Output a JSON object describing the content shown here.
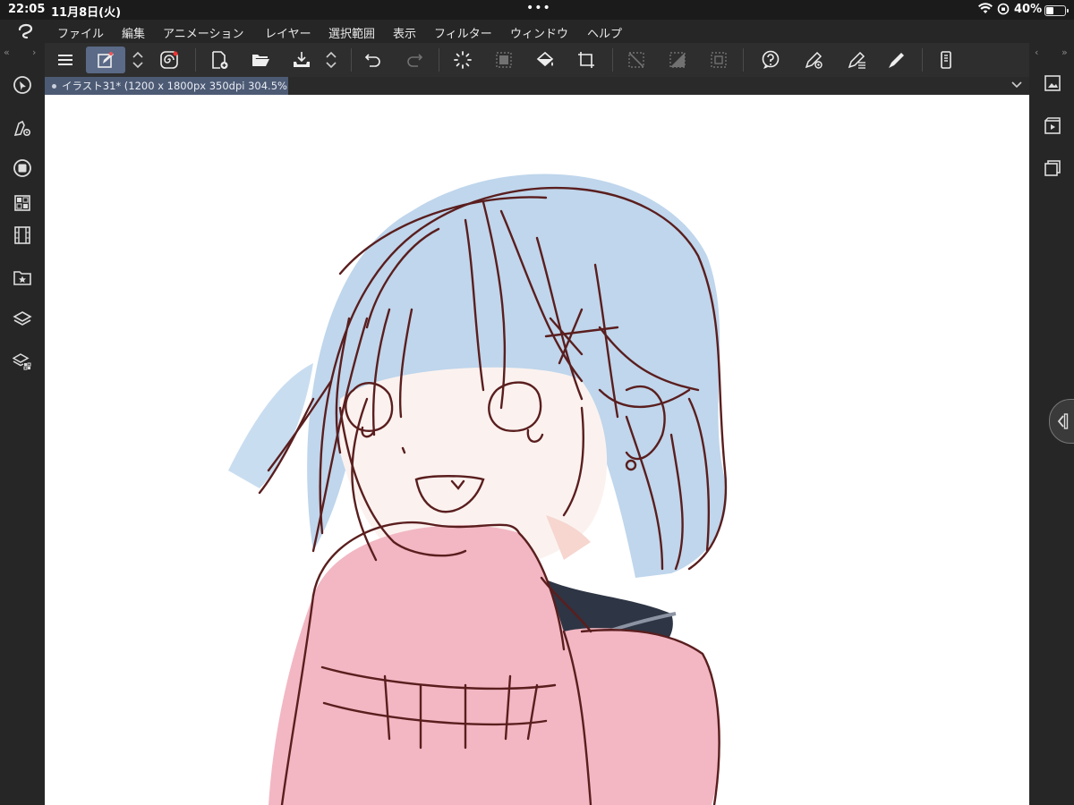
{
  "status_bar": {
    "time": "22:05",
    "date": "11月8日(火)",
    "battery_percent": "40%",
    "battery_level": 0.4
  },
  "menu": {
    "items": [
      "ファイル",
      "編集",
      "アニメーション",
      "レイヤー",
      "選択範囲",
      "表示",
      "フィルター",
      "ウィンドウ",
      "ヘルプ"
    ]
  },
  "toolbar": {
    "icons": [
      "menu-icon",
      "edit-tool-icon",
      "swap-updown-icon",
      "spiral-icon",
      "new-canvas-icon",
      "open-folder-icon",
      "save-icon",
      "swap-updown-icon",
      "undo-icon",
      "redo-icon",
      "loading-icon",
      "select-all-icon",
      "fill-icon",
      "crop-icon",
      "deselect-icon",
      "invert-selection-icon",
      "show-selection-icon",
      "help-icon",
      "pen-settings-icon",
      "pen-edit-icon",
      "brush-icon",
      "device-icon"
    ]
  },
  "document": {
    "tab_title": "イラスト31* (1200 x 1800px 350dpi 304.5%)"
  },
  "left_palette": {
    "icons": [
      "navigator-icon",
      "tool-settings-icon",
      "color-circle-icon",
      "color-set-icon",
      "timeline-icon",
      "materials-icon",
      "layers-icon",
      "layer-property-icon"
    ]
  },
  "right_palette": {
    "icons": [
      "canvas-icon",
      "animation-icon",
      "layer-stack-icon"
    ]
  },
  "colors": {
    "background": "#1e1e1e",
    "menubar": "#262626",
    "toolbar": "#2e2e2e",
    "active_tool": "#5a6a87",
    "tab": "#4d5a74",
    "canvas": "#ffffff",
    "hair": "#bfd6ec",
    "skin": "#fbf2ef",
    "sweater": "#f2b7c3",
    "collar": "#2e3544",
    "line": "#5a1e1e"
  }
}
